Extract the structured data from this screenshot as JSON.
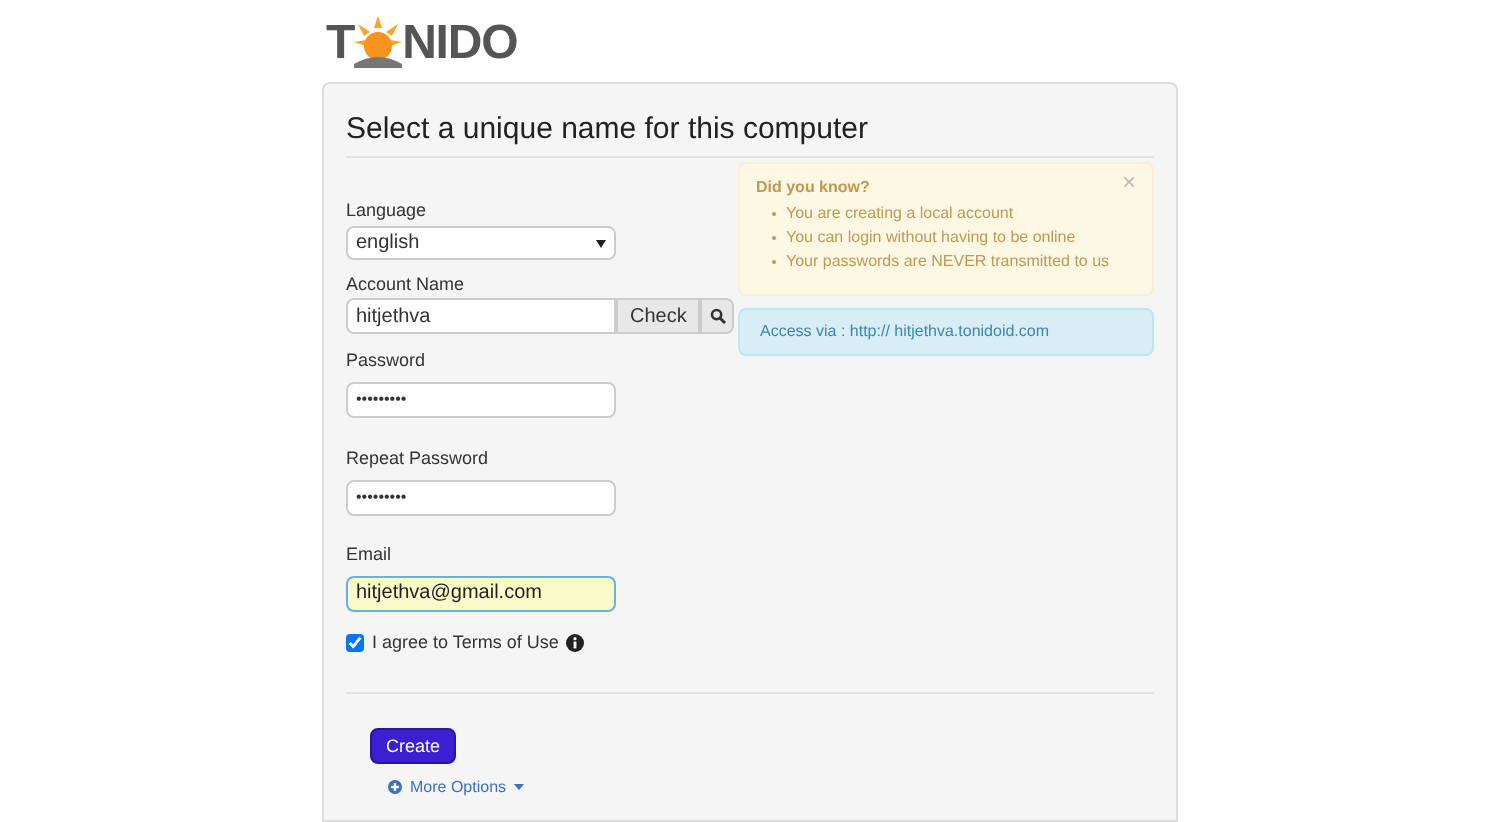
{
  "logo": {
    "left": "T",
    "right": "NIDO"
  },
  "title": "Select a unique name for this computer",
  "form": {
    "language": {
      "label": "Language",
      "value": "english"
    },
    "account": {
      "label": "Account Name",
      "value": "hitjethva",
      "check_button": "Check"
    },
    "password": {
      "label": "Password",
      "value": "•••••••••"
    },
    "repeat_password": {
      "label": "Repeat Password",
      "value": "•••••••••"
    },
    "email": {
      "label": "Email",
      "value": "hitjethva@gmail.com",
      "focused": true
    },
    "terms": {
      "label": "I agree to Terms of Use",
      "checked": true
    }
  },
  "info": {
    "title": "Did you know?",
    "close": "×",
    "items": [
      "You are creating a local account",
      "You can login without having to be online",
      "Your passwords are NEVER transmitted to us"
    ]
  },
  "access": "Access via : http:// hitjethva.tonidoid.com",
  "create_button": "Create",
  "more_options": "More Options"
}
